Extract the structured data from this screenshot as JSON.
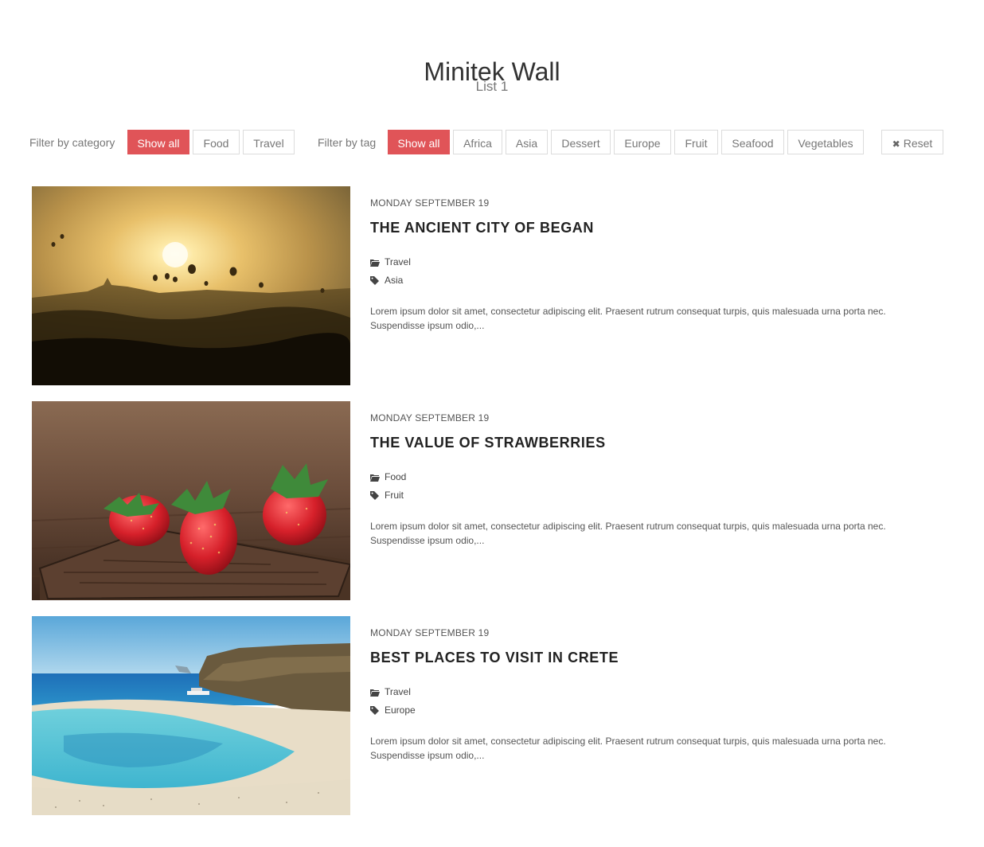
{
  "header": {
    "title": "Minitek Wall",
    "subtitle": "List 1"
  },
  "filters": {
    "category_label": "Filter by category",
    "category_buttons": [
      "Show all",
      "Food",
      "Travel"
    ],
    "tag_label": "Filter by tag",
    "tag_buttons": [
      "Show all",
      "Africa",
      "Asia",
      "Dessert",
      "Europe",
      "Fruit",
      "Seafood",
      "Vegetables"
    ],
    "reset_label": "Reset",
    "active_color": "#e05458"
  },
  "items": [
    {
      "date": "MONDAY SEPTEMBER 19",
      "title": "THE ANCIENT CITY OF BEGAN",
      "category": "Travel",
      "tag": "Asia",
      "description": "Lorem ipsum dolor sit amet, consectetur adipiscing elit. Praesent rutrum consequat turpis, quis malesuada urna porta nec. Suspendisse ipsum odio,...",
      "image": "sunrise-balloons-image"
    },
    {
      "date": "MONDAY SEPTEMBER 19",
      "title": "THE VALUE OF STRAWBERRIES",
      "category": "Food",
      "tag": "Fruit",
      "description": "Lorem ipsum dolor sit amet, consectetur adipiscing elit. Praesent rutrum consequat turpis, quis malesuada urna porta nec. Suspendisse ipsum odio,...",
      "image": "strawberries-image"
    },
    {
      "date": "MONDAY SEPTEMBER 19",
      "title": "BEST PLACES TO VISIT IN CRETE",
      "category": "Travel",
      "tag": "Europe",
      "description": "Lorem ipsum dolor sit amet, consectetur adipiscing elit. Praesent rutrum consequat turpis, quis malesuada urna porta nec. Suspendisse ipsum odio,...",
      "image": "beach-lagoon-image"
    }
  ]
}
